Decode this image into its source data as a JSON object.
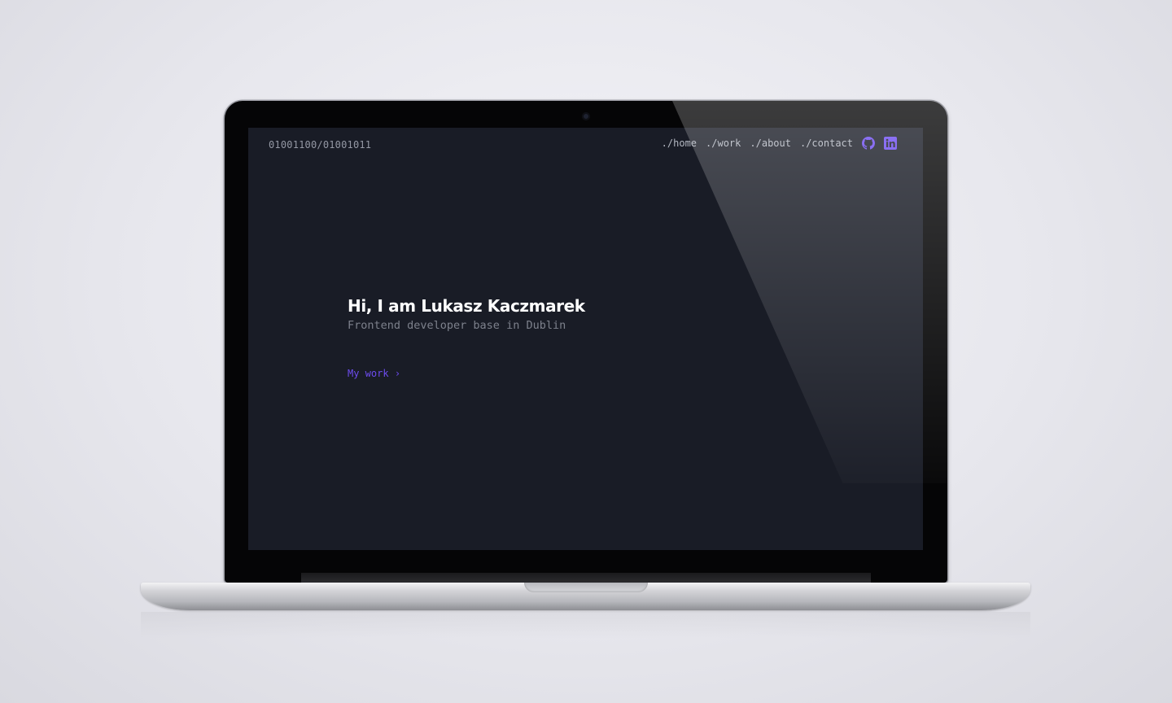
{
  "site": {
    "logo": "01001100/01001011",
    "nav": [
      {
        "label": "./home"
      },
      {
        "label": "./work"
      },
      {
        "label": "./about"
      },
      {
        "label": "./contact"
      }
    ],
    "social": [
      {
        "icon": "github-icon"
      },
      {
        "icon": "linkedin-icon"
      }
    ],
    "hero": {
      "title": "Hi, I am Lukasz Kaczmarek",
      "subtitle": "Frontend developer base in Dublin",
      "cta_label": "My work",
      "cta_icon": "chevron-right-icon"
    }
  },
  "colors": {
    "background": "#191c26",
    "accent": "#6d4cf0",
    "text": "#ffffff",
    "muted": "#7d818c"
  }
}
